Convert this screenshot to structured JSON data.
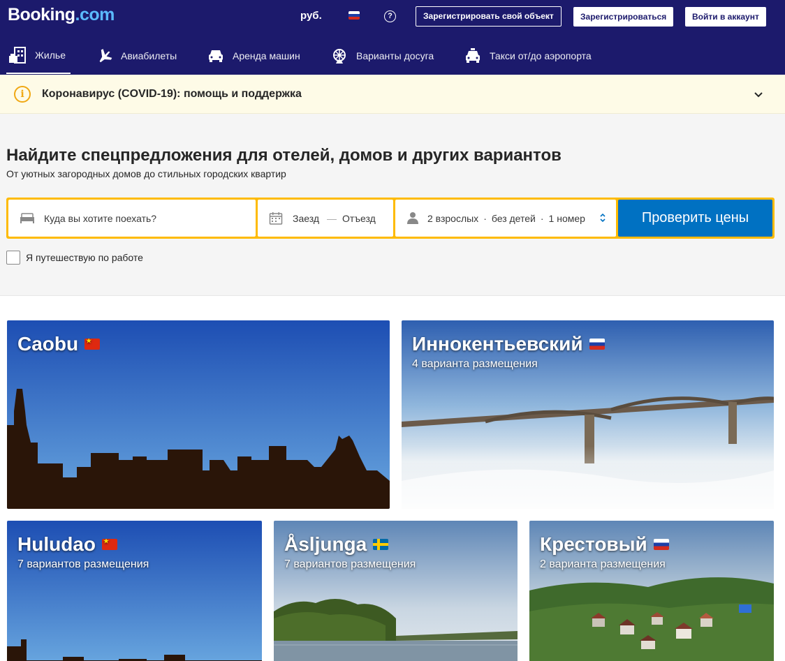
{
  "header": {
    "logo_main": "Booking",
    "logo_suffix": ".com",
    "currency": "руб.",
    "list_property": "Зарегистрировать свой объект",
    "register": "Зарегистрироваться",
    "signin": "Войти в аккаунт"
  },
  "nav": {
    "tabs": [
      {
        "label": "Жилье",
        "icon": "bed-building-icon",
        "active": true
      },
      {
        "label": "Авиабилеты",
        "icon": "plane-icon",
        "active": false
      },
      {
        "label": "Аренда машин",
        "icon": "car-icon",
        "active": false
      },
      {
        "label": "Варианты досуга",
        "icon": "ferris-wheel-icon",
        "active": false
      },
      {
        "label": "Такси от/до аэропорта",
        "icon": "taxi-icon",
        "active": false
      }
    ]
  },
  "covid": {
    "text": "Коронавирус (COVID-19): помощь и поддержка"
  },
  "search": {
    "title": "Найдите спецпредложения для отелей, домов и других вариантов",
    "subtitle": "От уютных загородных домов до стильных городских квартир",
    "destination_placeholder": "Куда вы хотите поехать?",
    "checkin": "Заезд",
    "checkout": "Отъезд",
    "adults": "2 взрослых",
    "children": "без детей",
    "rooms": "1 номер",
    "submit": "Проверить цены",
    "work_trip": "Я путешествую по работе"
  },
  "destinations": [
    {
      "name": "Caobu",
      "flag": "cn",
      "count": ""
    },
    {
      "name": "Иннокентьевский",
      "flag": "ru",
      "count": "4 варианта размещения"
    },
    {
      "name": "Huludao",
      "flag": "cn",
      "count": "7 вариантов размещения"
    },
    {
      "name": "Åsljunga",
      "flag": "se",
      "count": "7 вариантов размещения"
    },
    {
      "name": "Крестовый",
      "flag": "ru",
      "count": "2 варианта размещения"
    }
  ],
  "colors": {
    "header_bg": "#1c1a6c",
    "accent_yellow": "#febb02",
    "button_blue": "#0071c2",
    "covid_bg": "#fefbe7"
  }
}
